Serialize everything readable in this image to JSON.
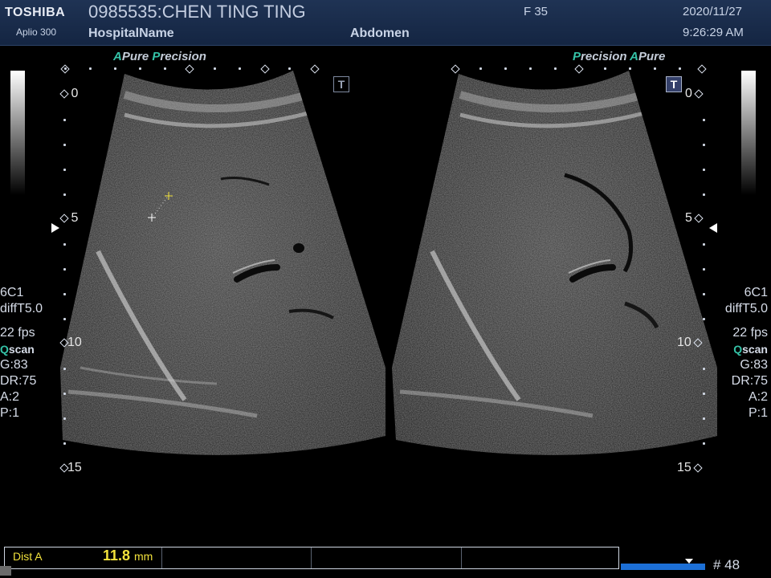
{
  "header": {
    "brand": "TOSHIBA",
    "model": "Aplio 300",
    "patient": "0985535:CHEN TING TING",
    "hospital": "HospitalName",
    "exam": "Abdomen",
    "frequency": "F  35",
    "date": "2020/11/27",
    "time": "9:26:29 AM"
  },
  "tagline_left": {
    "part1_mark": "A",
    "part1": "Pure",
    "part2_mark": "P",
    "part2": "recision"
  },
  "tagline_right": {
    "part1_mark": "P",
    "part1": "recision",
    "part2_mark": "A",
    "part2": "Pure"
  },
  "depth_labels": [
    "0",
    "5",
    "10",
    "15"
  ],
  "left_info": {
    "probe": "6C1",
    "filter": "diffT5.0",
    "fps": "22 fps",
    "scan_mark": "Q",
    "scan": "scan",
    "gain": "G:83",
    "dr": "DR:75",
    "a": "A:2",
    "p": "P:1"
  },
  "right_info": {
    "probe": "6C1",
    "filter": "diffT5.0",
    "fps": "22 fps",
    "scan_mark": "Q",
    "scan": "scan",
    "gain": "G:83",
    "dr": "DR:75",
    "a": "A:2",
    "p": "P:1"
  },
  "t_marker": "T",
  "measurement": {
    "name": "Dist A",
    "value": "11.8",
    "unit": "mm"
  },
  "frame_number": "# 48",
  "colors": {
    "header_bg": "#1a2d4c",
    "measure_yellow": "#f2e23c",
    "accent_green": "#35c2a7",
    "cine_blue": "#1c6fd6"
  }
}
